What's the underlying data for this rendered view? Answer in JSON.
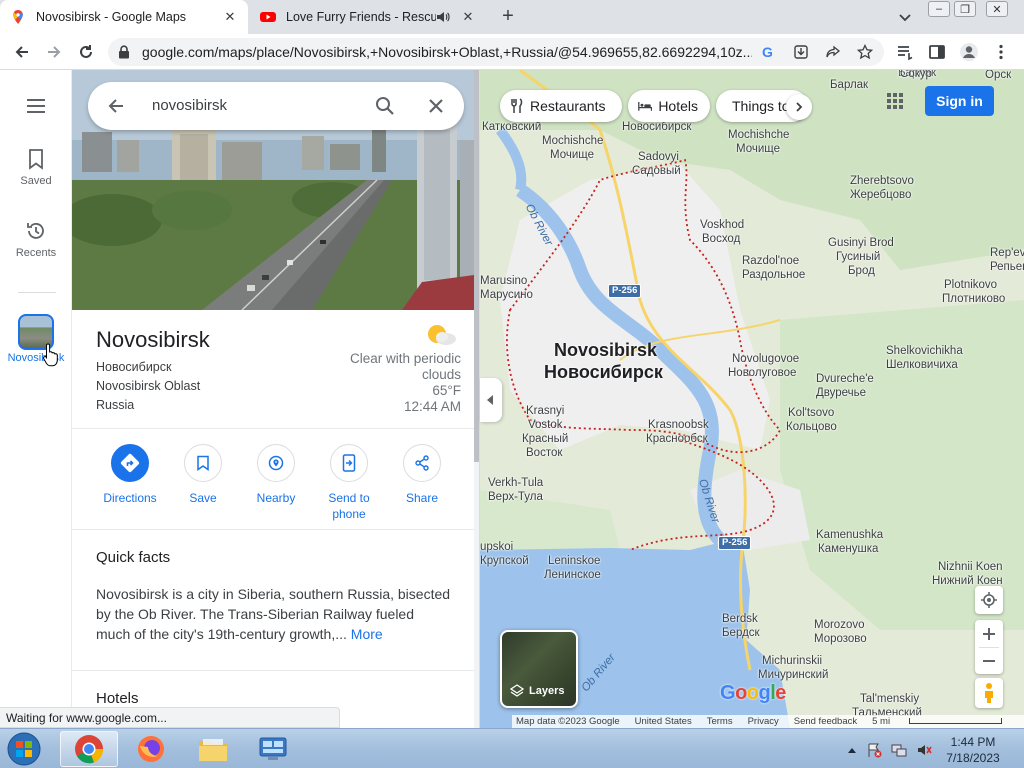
{
  "browser": {
    "tabs": [
      {
        "title": "Novosibirsk - Google Maps",
        "active": true
      },
      {
        "title": "Love Furry Friends - Rescue",
        "active": false
      }
    ],
    "url": "google.com/maps/place/Novosibirsk,+Novosibirsk+Oblast,+Russia/@54.969655,82.6692294,10z...",
    "status_text": "Waiting for www.google.com..."
  },
  "rail": {
    "menu_icon": "menu-icon",
    "saved_label": "Saved",
    "recents_label": "Recents",
    "recent_place_label": "Novosibirsk"
  },
  "search": {
    "query": "novosibirsk"
  },
  "place": {
    "name": "Novosibirsk",
    "native_name": "Новосибирск",
    "region": "Novosibirsk Oblast",
    "country": "Russia",
    "weather": {
      "condition": "Clear with periodic clouds",
      "temp": "65°F",
      "time": "12:44 AM"
    }
  },
  "actions": [
    {
      "label": "Directions",
      "icon": "directions-icon"
    },
    {
      "label": "Save",
      "icon": "bookmark-icon"
    },
    {
      "label": "Nearby",
      "icon": "nearby-icon"
    },
    {
      "label": "Send to phone",
      "icon": "send-to-phone-icon"
    },
    {
      "label": "Share",
      "icon": "share-icon"
    }
  ],
  "quick_facts": {
    "title": "Quick facts",
    "text": "Novosibirsk is a city in Siberia, southern Russia, bisected by the Ob River. The Trans-Siberian Railway fueled much of the city's 19th-century growth,...",
    "more": "More"
  },
  "hotels_title": "Hotels",
  "map": {
    "chips": [
      "Restaurants",
      "Hotels",
      "Things to do"
    ],
    "signin": "Sign in",
    "layers": "Layers",
    "road": "P-256",
    "labels": {
      "city_en": "Novosibirsk",
      "city_ru": "Новосибирск",
      "ob_river": "Ob River",
      "katkovskiy": "Катковский",
      "novosibirsk_top": "Новосибирск",
      "sokur": "Сокур",
      "orsk": "Орск",
      "barlak_en": "Барлак",
      "barlak": "Барлак",
      "mochishche_w_en": "Mochishche",
      "mochishche_w_ru": "Мочище",
      "mochishche_e_en": "Mochishche",
      "mochishche_e_ru": "Мочище",
      "sadovyi_en": "Sadovyi",
      "sadovyi_ru": "Садовый",
      "zherebtsovo_en": "Zherebtsovo",
      "zherebtsovo_ru": "Жеребцово",
      "voskhod_en": "Voskhod",
      "voskhod_ru": "Восход",
      "razdolnoe_en": "Razdol'noe",
      "razdolnoe_ru": "Раздольное",
      "gusinyi_en": "Gusinyi Brod",
      "gusinyi_ru1": "Гусиный",
      "gusinyi_ru2": "Брод",
      "repevka_en": "Rep'evk",
      "repevka_ru": "Репьевк",
      "plotnikovo_en": "Plotnikovo",
      "plotnikovo_ru": "Плотниково",
      "marusino_en": "Marusino",
      "marusino_ru": "Марусино",
      "novolugovoe_en": "Novolugovoe",
      "novolugovoe_ru": "Новолуговое",
      "shelkovichikha_en": "Shelkovichikha",
      "shelkovichikha_ru": "Шелковичиха",
      "dvureche_en": "Dvureche'e",
      "dvureche_ru": "Двуречье",
      "krasnyi_en1": "Krasnyi",
      "krasnyi_en2": "Vostok",
      "krasnyi_ru1": "Красный",
      "krasnyi_ru2": "Восток",
      "krasnoobsk_en": "Krasnoobsk",
      "krasnoobsk_ru": "Краснообск",
      "koltsovo_en": "Kol'tsovo",
      "koltsovo_ru": "Кольцово",
      "verkh_tula_en": "Verkh-Tula",
      "verkh_tula_ru": "Верх-Тула",
      "krupskoi_en": "upskoi",
      "krupskoi_ru": "Крупской",
      "leninskoe_en": "Leninskoe",
      "leninskoe_ru": "Ленинское",
      "kamenushka_en": "Kamenushka",
      "kamenushka_ru": "Каменушка",
      "nizhnii_en": "Nizhnii Koen",
      "nizhnii_ru": "Нижний Коен",
      "berdsk_en": "Berdsk",
      "berdsk_ru": "Бердск",
      "morozovo_en": "Morozovo",
      "morozovo_ru": "Морозово",
      "michurinskii_en": "Michurinskii",
      "michurinskii_ru": "Мичуринский",
      "talmenskiy_en": "Tal'menskiy",
      "talmenskiy_ru": "Тальменский"
    },
    "attribution": {
      "map_data": "Map data ©2023 Google",
      "country": "United States",
      "terms": "Terms",
      "privacy": "Privacy",
      "feedback": "Send feedback",
      "scale": "5 mi"
    }
  },
  "taskbar": {
    "time": "1:44 PM",
    "date": "7/18/2023"
  }
}
